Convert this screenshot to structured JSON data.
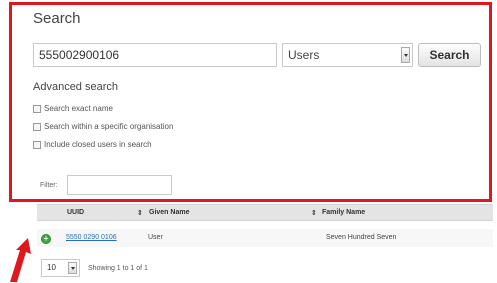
{
  "search": {
    "title": "Search",
    "query_value": "555002900106",
    "type_selected": "Users",
    "button_label": "Search"
  },
  "advanced": {
    "title": "Advanced search",
    "options": [
      {
        "label": "Search exact name",
        "checked": false
      },
      {
        "label": "Search within a specific organisation",
        "checked": false
      },
      {
        "label": "Include closed users in search",
        "checked": false
      }
    ]
  },
  "filter": {
    "label": "Filter:",
    "value": ""
  },
  "table": {
    "columns": [
      "UUID",
      "Given Name",
      "Family Name"
    ],
    "rows": [
      {
        "uuid": "5550 0290 0106",
        "given_name": "User",
        "family_name": "Seven Hundred Seven"
      }
    ]
  },
  "pagination": {
    "page_size": "10",
    "showing_text": "Showing 1 to 1 of 1"
  },
  "colors": {
    "highlight": "#e0171c",
    "link": "#2a6ebb",
    "expand": "#3ea83e"
  }
}
